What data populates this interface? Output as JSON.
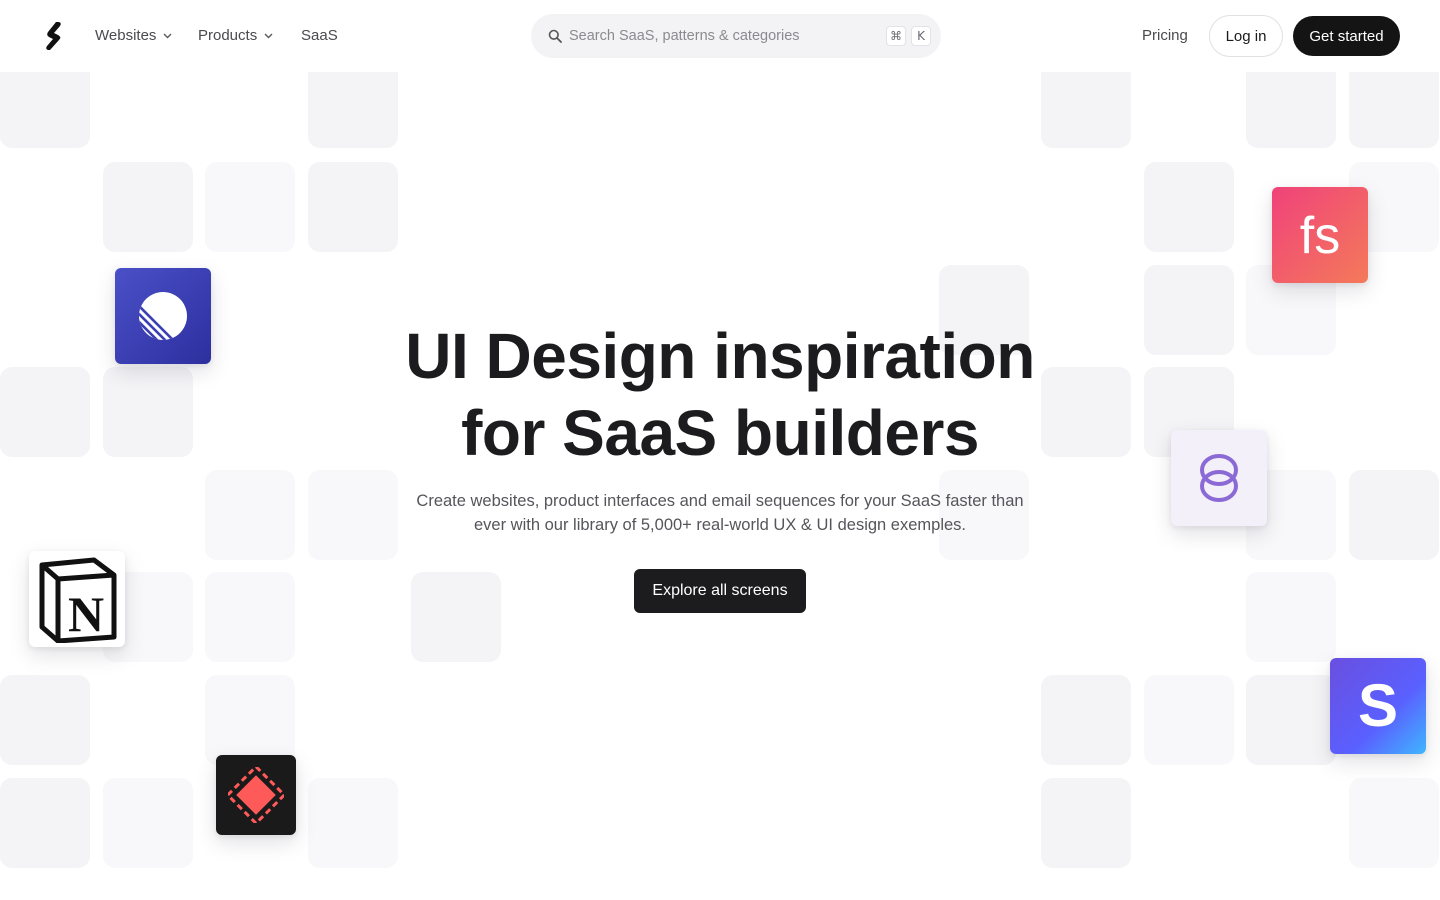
{
  "header": {
    "logo_icon": "superdesign-logo-icon",
    "nav": [
      {
        "label": "Websites",
        "has_dropdown": true
      },
      {
        "label": "Products",
        "has_dropdown": true
      },
      {
        "label": "SaaS",
        "has_dropdown": false
      }
    ],
    "search": {
      "placeholder": "Search SaaS, patterns & categories",
      "shortcut_keys": [
        "⌘",
        "K"
      ]
    },
    "pricing_label": "Pricing",
    "login_label": "Log in",
    "get_started_label": "Get started"
  },
  "hero": {
    "title_lines": [
      "UI Design inspiration",
      "for SaaS builders"
    ],
    "subtitle_lines": [
      "Create websites, product interfaces and email sequences for your SaaS faster than",
      "ever with our library of 5,000+ real-world UX & UI design exemples."
    ],
    "cta_label": "Explore all screens"
  },
  "app_icons": [
    {
      "name": "linear-app-icon",
      "color": "#3b3fb8"
    },
    {
      "name": "notion-app-icon",
      "color": "#ffffff"
    },
    {
      "name": "raycast-app-icon",
      "color": "#1a1a1a"
    },
    {
      "name": "fullstory-app-icon",
      "color": "#f0556e"
    },
    {
      "name": "supabase-style-app-icon",
      "color": "#f3f0fa"
    },
    {
      "name": "stripe-app-icon",
      "color": "#635bff"
    }
  ],
  "colors": {
    "primary_dark": "#141414",
    "tile_bg": "#f4f4f7",
    "text_muted": "#55555b"
  }
}
